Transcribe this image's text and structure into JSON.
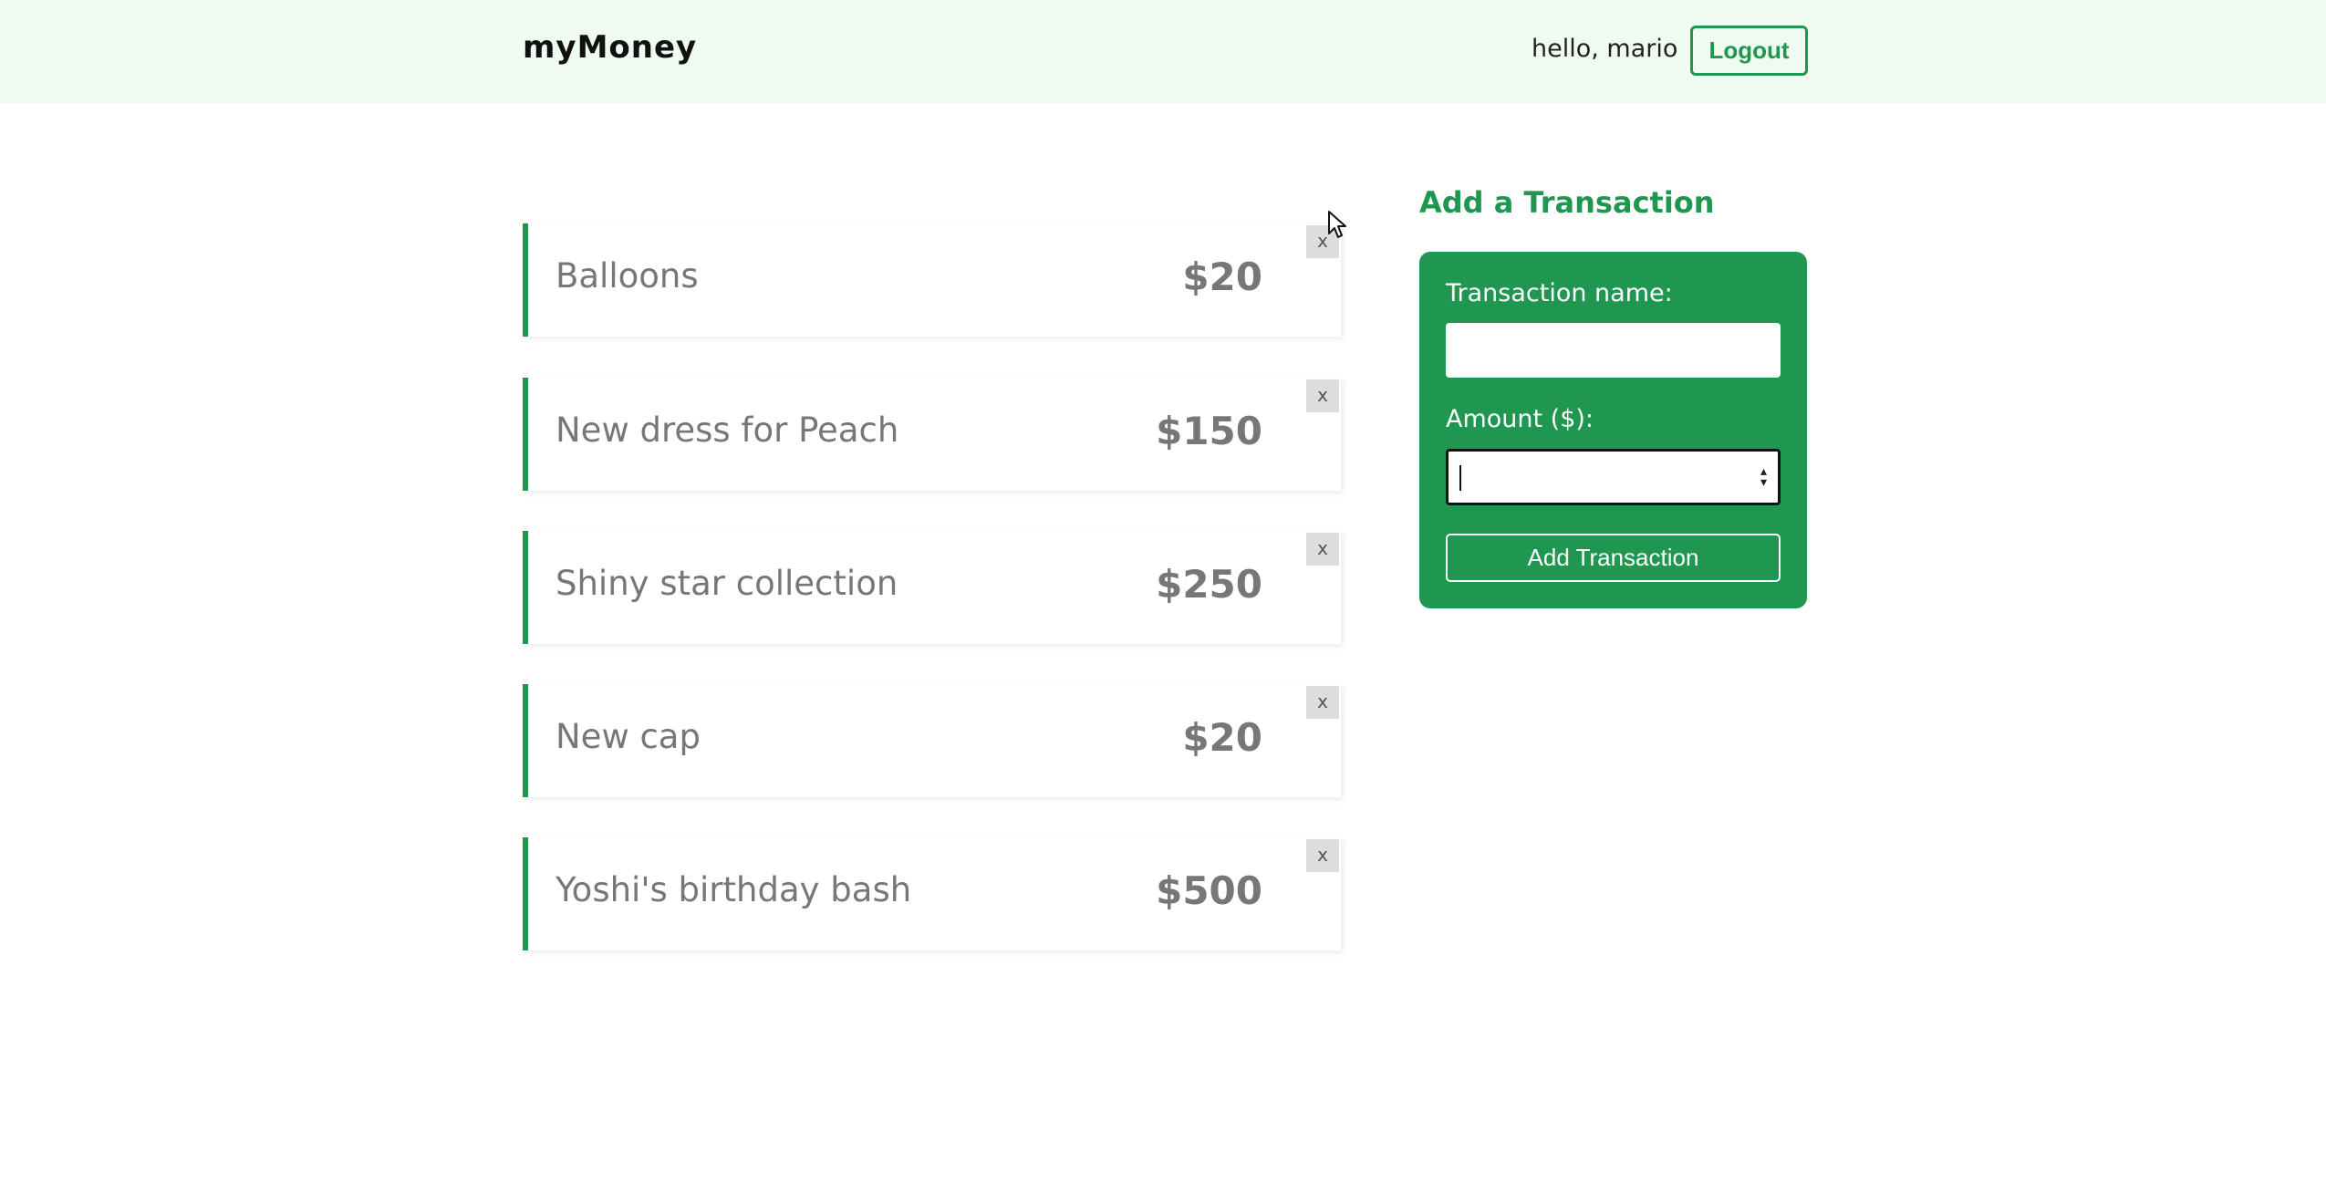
{
  "navbar": {
    "brand": "myMoney",
    "greeting": "hello, mario",
    "logout_label": "Logout"
  },
  "transactions": [
    {
      "name": "Balloons",
      "amount": "$20",
      "delete_label": "x"
    },
    {
      "name": "New dress for Peach",
      "amount": "$150",
      "delete_label": "x"
    },
    {
      "name": "Shiny star collection",
      "amount": "$250",
      "delete_label": "x"
    },
    {
      "name": "New cap",
      "amount": "$20",
      "delete_label": "x"
    },
    {
      "name": "Yoshi's birthday bash",
      "amount": "$500",
      "delete_label": "x"
    }
  ],
  "form": {
    "title": "Add a Transaction",
    "name_label": "Transaction name:",
    "name_value": "",
    "amount_label": "Amount ($):",
    "amount_value": "",
    "submit_label": "Add Transaction"
  },
  "colors": {
    "accent": "#1f9751",
    "navbar_bg": "#effaf0"
  },
  "icons": {
    "cursor": "mouse-pointer-icon",
    "spinner": "number-spinner-icon"
  }
}
